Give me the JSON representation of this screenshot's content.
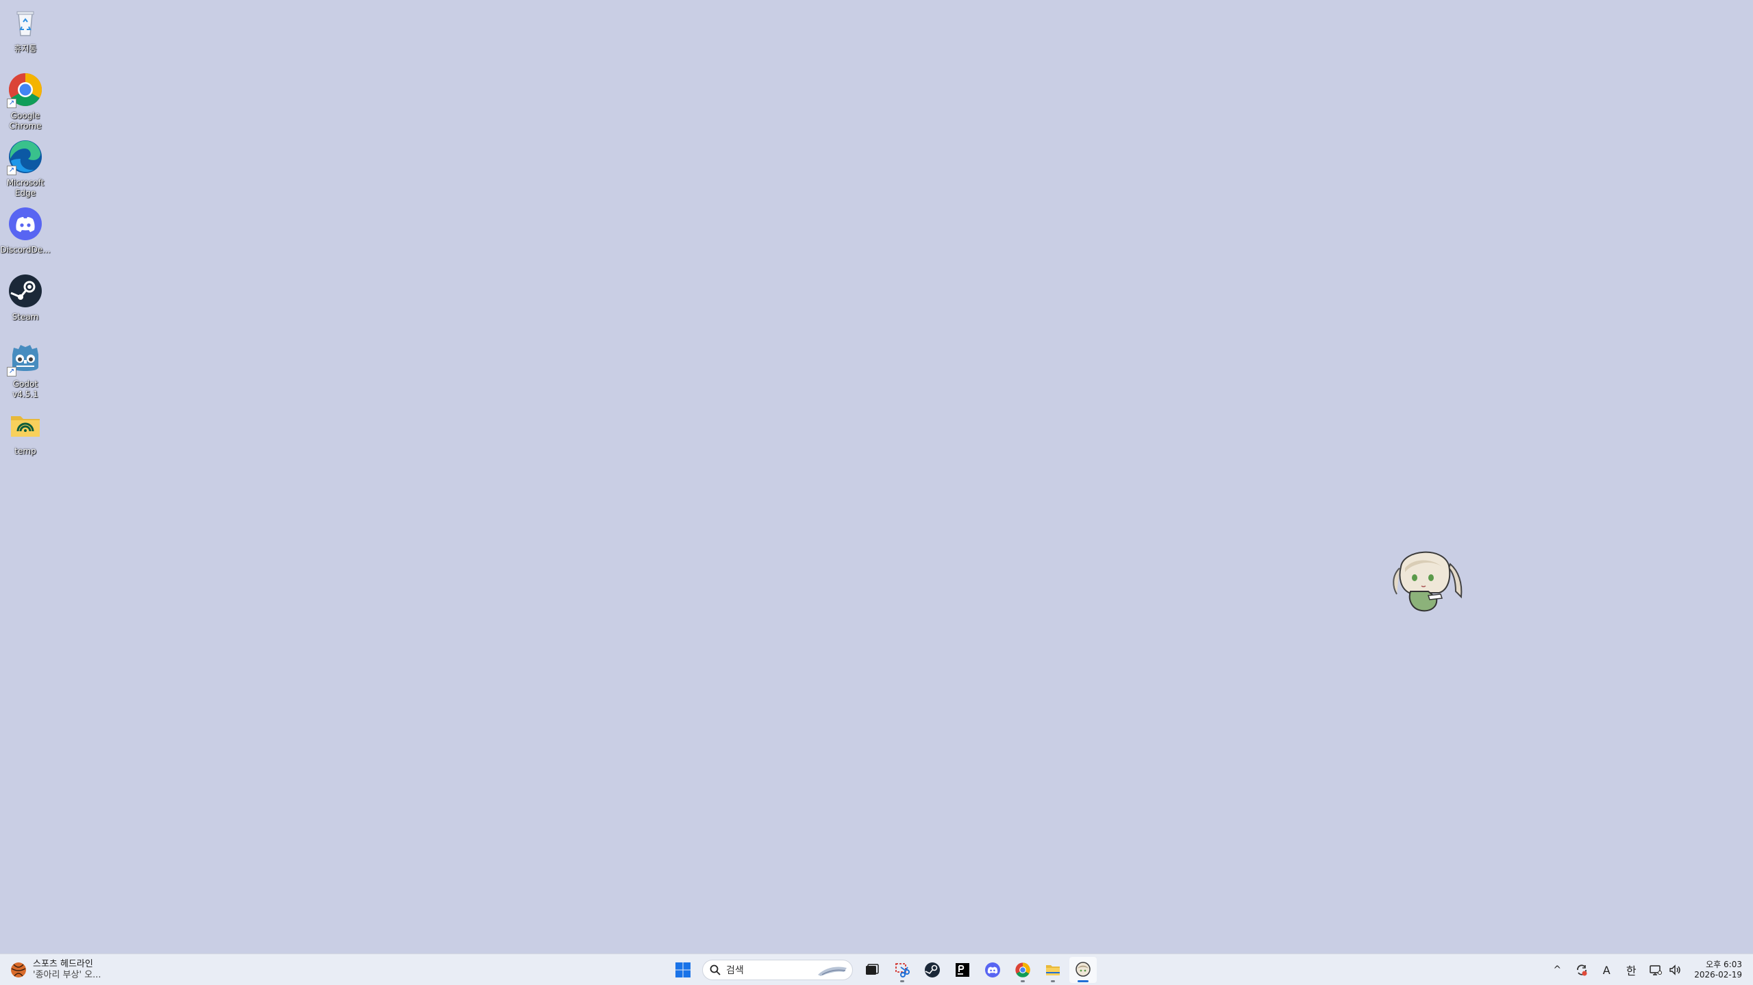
{
  "desktop": {
    "background_color": "#c9cee4",
    "icons": [
      {
        "label": "휴지통",
        "icon": "recycle-bin-icon"
      },
      {
        "label": "Google Chrome",
        "icon": "chrome-icon"
      },
      {
        "label": "Microsoft Edge",
        "icon": "edge-icon"
      },
      {
        "label": "DiscordDe...",
        "icon": "discord-icon"
      },
      {
        "label": "Steam",
        "icon": "steam-icon"
      },
      {
        "label": "Godot v4.5.1",
        "icon": "godot-icon"
      },
      {
        "label": "temp",
        "icon": "folder-icon"
      }
    ],
    "mascot": {
      "icon": "chibi-mascot-icon"
    }
  },
  "taskbar": {
    "widget": {
      "title": "스포츠 헤드라인",
      "subtitle": "'종아리 부상' 오...",
      "icon": "sports-news-icon"
    },
    "start": {
      "icon": "windows-start-icon"
    },
    "search": {
      "placeholder": "검색",
      "icon": "search-icon"
    },
    "apps": [
      {
        "name": "task-view",
        "icon": "task-view-icon",
        "running": false
      },
      {
        "name": "snipping-tool",
        "icon": "snipping-tool-icon",
        "running": true
      },
      {
        "name": "steam",
        "icon": "steam-icon",
        "running": false
      },
      {
        "name": "pycharm",
        "icon": "pycharm-icon",
        "running": false
      },
      {
        "name": "discord",
        "icon": "discord-icon",
        "running": false
      },
      {
        "name": "chrome",
        "icon": "chrome-icon",
        "running": true
      },
      {
        "name": "file-explorer",
        "icon": "folder-icon",
        "running": true
      },
      {
        "name": "mascot-app",
        "icon": "chibi-mascot-icon",
        "running": true,
        "active": true
      }
    ],
    "tray": {
      "chevron": "^",
      "ime_mode": "A",
      "ime_lang": "한",
      "volume": "🕪",
      "clock": {
        "time": "오후 6:03",
        "date": "2026-02-19"
      }
    }
  }
}
